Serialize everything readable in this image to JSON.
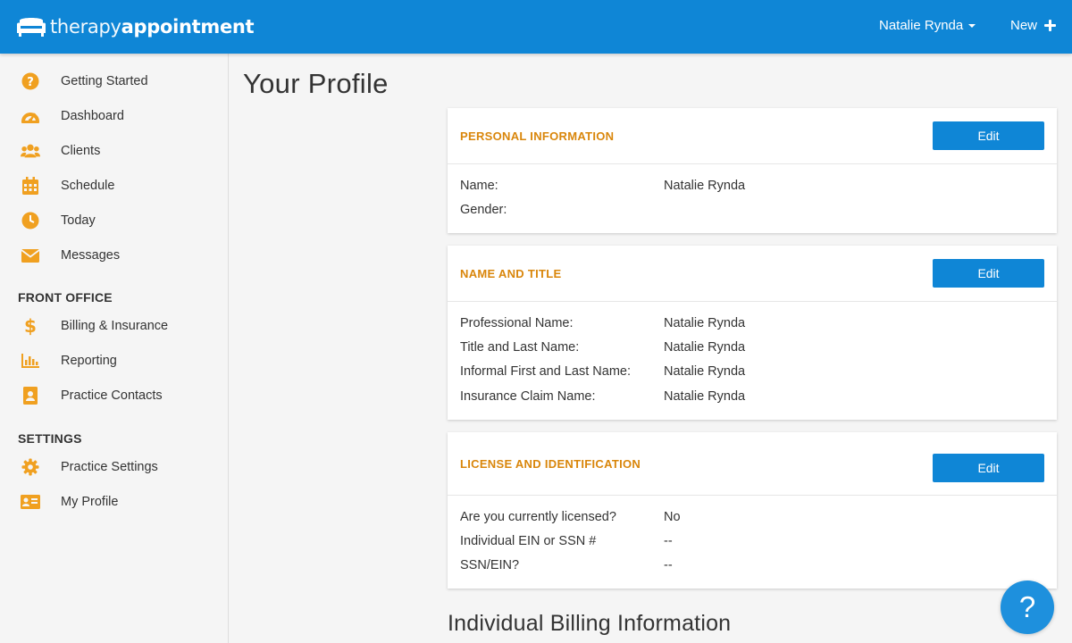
{
  "brand": {
    "light": "therapy",
    "bold": "appointment",
    "logo_icon": "sofa-icon"
  },
  "header": {
    "user_name": "Natalie Rynda",
    "new_label": "New"
  },
  "colors": {
    "primary": "#0f86d6",
    "accent": "#f0a020",
    "section_title": "#d9860b"
  },
  "sidebar": {
    "items": [
      {
        "label": "Getting Started",
        "icon": "question-circle-icon"
      },
      {
        "label": "Dashboard",
        "icon": "gauge-icon"
      },
      {
        "label": "Clients",
        "icon": "users-icon"
      },
      {
        "label": "Schedule",
        "icon": "calendar-icon"
      },
      {
        "label": "Today",
        "icon": "clock-icon"
      },
      {
        "label": "Messages",
        "icon": "envelope-icon"
      }
    ],
    "front_office_heading": "FRONT OFFICE",
    "front_office": [
      {
        "label": "Billing & Insurance",
        "icon": "dollar-icon"
      },
      {
        "label": "Reporting",
        "icon": "bar-chart-icon"
      },
      {
        "label": "Practice Contacts",
        "icon": "address-book-icon"
      }
    ],
    "settings_heading": "SETTINGS",
    "settings": [
      {
        "label": "Practice Settings",
        "icon": "gear-icon"
      },
      {
        "label": "My Profile",
        "icon": "id-card-icon"
      }
    ]
  },
  "page": {
    "title": "Your Profile",
    "billing_heading": "Individual Billing Information"
  },
  "cards": {
    "personal": {
      "title": "PERSONAL INFORMATION",
      "edit": "Edit",
      "rows": [
        {
          "key": "Name:",
          "value": "Natalie Rynda"
        },
        {
          "key": "Gender:",
          "value": ""
        }
      ]
    },
    "name_title": {
      "title": "NAME AND TITLE",
      "edit": "Edit",
      "rows": [
        {
          "key": "Professional Name:",
          "value": "Natalie Rynda"
        },
        {
          "key": "Title and Last Name:",
          "value": "Natalie Rynda"
        },
        {
          "key": "Informal First and Last Name:",
          "value": "Natalie Rynda"
        },
        {
          "key": "Insurance Claim Name:",
          "value": "Natalie Rynda"
        }
      ]
    },
    "license": {
      "title": "LICENSE AND IDENTIFICATION",
      "edit": "Edit",
      "rows": [
        {
          "key": "Are you currently licensed?",
          "value": "No"
        },
        {
          "key": "Individual EIN or SSN #",
          "value": "--"
        },
        {
          "key": "SSN/EIN?",
          "value": "--"
        }
      ]
    }
  },
  "help": {
    "label": "?"
  }
}
